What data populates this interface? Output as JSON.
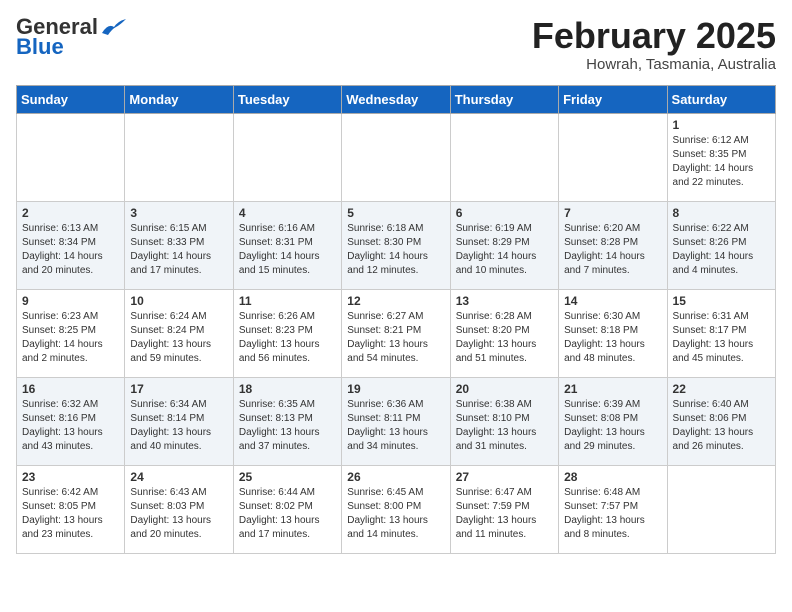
{
  "header": {
    "logo_general": "General",
    "logo_blue": "Blue",
    "month_title": "February 2025",
    "location": "Howrah, Tasmania, Australia"
  },
  "days_of_week": [
    "Sunday",
    "Monday",
    "Tuesday",
    "Wednesday",
    "Thursday",
    "Friday",
    "Saturday"
  ],
  "weeks": [
    [
      {
        "day": "",
        "info": ""
      },
      {
        "day": "",
        "info": ""
      },
      {
        "day": "",
        "info": ""
      },
      {
        "day": "",
        "info": ""
      },
      {
        "day": "",
        "info": ""
      },
      {
        "day": "",
        "info": ""
      },
      {
        "day": "1",
        "info": "Sunrise: 6:12 AM\nSunset: 8:35 PM\nDaylight: 14 hours\nand 22 minutes."
      }
    ],
    [
      {
        "day": "2",
        "info": "Sunrise: 6:13 AM\nSunset: 8:34 PM\nDaylight: 14 hours\nand 20 minutes."
      },
      {
        "day": "3",
        "info": "Sunrise: 6:15 AM\nSunset: 8:33 PM\nDaylight: 14 hours\nand 17 minutes."
      },
      {
        "day": "4",
        "info": "Sunrise: 6:16 AM\nSunset: 8:31 PM\nDaylight: 14 hours\nand 15 minutes."
      },
      {
        "day": "5",
        "info": "Sunrise: 6:18 AM\nSunset: 8:30 PM\nDaylight: 14 hours\nand 12 minutes."
      },
      {
        "day": "6",
        "info": "Sunrise: 6:19 AM\nSunset: 8:29 PM\nDaylight: 14 hours\nand 10 minutes."
      },
      {
        "day": "7",
        "info": "Sunrise: 6:20 AM\nSunset: 8:28 PM\nDaylight: 14 hours\nand 7 minutes."
      },
      {
        "day": "8",
        "info": "Sunrise: 6:22 AM\nSunset: 8:26 PM\nDaylight: 14 hours\nand 4 minutes."
      }
    ],
    [
      {
        "day": "9",
        "info": "Sunrise: 6:23 AM\nSunset: 8:25 PM\nDaylight: 14 hours\nand 2 minutes."
      },
      {
        "day": "10",
        "info": "Sunrise: 6:24 AM\nSunset: 8:24 PM\nDaylight: 13 hours\nand 59 minutes."
      },
      {
        "day": "11",
        "info": "Sunrise: 6:26 AM\nSunset: 8:23 PM\nDaylight: 13 hours\nand 56 minutes."
      },
      {
        "day": "12",
        "info": "Sunrise: 6:27 AM\nSunset: 8:21 PM\nDaylight: 13 hours\nand 54 minutes."
      },
      {
        "day": "13",
        "info": "Sunrise: 6:28 AM\nSunset: 8:20 PM\nDaylight: 13 hours\nand 51 minutes."
      },
      {
        "day": "14",
        "info": "Sunrise: 6:30 AM\nSunset: 8:18 PM\nDaylight: 13 hours\nand 48 minutes."
      },
      {
        "day": "15",
        "info": "Sunrise: 6:31 AM\nSunset: 8:17 PM\nDaylight: 13 hours\nand 45 minutes."
      }
    ],
    [
      {
        "day": "16",
        "info": "Sunrise: 6:32 AM\nSunset: 8:16 PM\nDaylight: 13 hours\nand 43 minutes."
      },
      {
        "day": "17",
        "info": "Sunrise: 6:34 AM\nSunset: 8:14 PM\nDaylight: 13 hours\nand 40 minutes."
      },
      {
        "day": "18",
        "info": "Sunrise: 6:35 AM\nSunset: 8:13 PM\nDaylight: 13 hours\nand 37 minutes."
      },
      {
        "day": "19",
        "info": "Sunrise: 6:36 AM\nSunset: 8:11 PM\nDaylight: 13 hours\nand 34 minutes."
      },
      {
        "day": "20",
        "info": "Sunrise: 6:38 AM\nSunset: 8:10 PM\nDaylight: 13 hours\nand 31 minutes."
      },
      {
        "day": "21",
        "info": "Sunrise: 6:39 AM\nSunset: 8:08 PM\nDaylight: 13 hours\nand 29 minutes."
      },
      {
        "day": "22",
        "info": "Sunrise: 6:40 AM\nSunset: 8:06 PM\nDaylight: 13 hours\nand 26 minutes."
      }
    ],
    [
      {
        "day": "23",
        "info": "Sunrise: 6:42 AM\nSunset: 8:05 PM\nDaylight: 13 hours\nand 23 minutes."
      },
      {
        "day": "24",
        "info": "Sunrise: 6:43 AM\nSunset: 8:03 PM\nDaylight: 13 hours\nand 20 minutes."
      },
      {
        "day": "25",
        "info": "Sunrise: 6:44 AM\nSunset: 8:02 PM\nDaylight: 13 hours\nand 17 minutes."
      },
      {
        "day": "26",
        "info": "Sunrise: 6:45 AM\nSunset: 8:00 PM\nDaylight: 13 hours\nand 14 minutes."
      },
      {
        "day": "27",
        "info": "Sunrise: 6:47 AM\nSunset: 7:59 PM\nDaylight: 13 hours\nand 11 minutes."
      },
      {
        "day": "28",
        "info": "Sunrise: 6:48 AM\nSunset: 7:57 PM\nDaylight: 13 hours\nand 8 minutes."
      },
      {
        "day": "",
        "info": ""
      }
    ]
  ]
}
